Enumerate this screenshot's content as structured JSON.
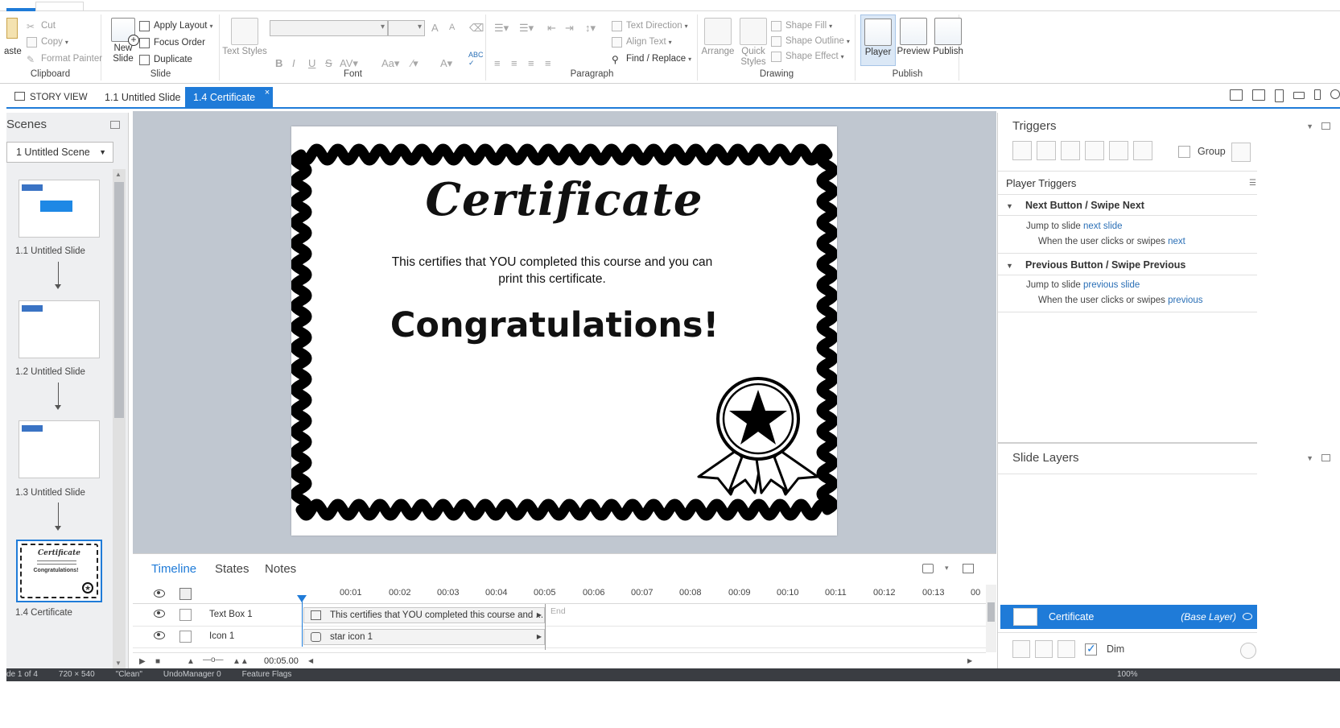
{
  "ribbon": {
    "clipboard": {
      "paste": "aste",
      "cut": "Cut",
      "copy": "Copy",
      "format_painter": "Format Painter",
      "label": "Clipboard"
    },
    "slide": {
      "new_slide": "New Slide",
      "apply_layout": "Apply Layout",
      "focus_order": "Focus Order",
      "duplicate": "Duplicate",
      "label": "Slide"
    },
    "font": {
      "text_styles": "Text Styles",
      "label": "Font"
    },
    "paragraph": {
      "text_direction": "Text Direction",
      "align_text": "Align Text",
      "find_replace": "Find / Replace",
      "label": "Paragraph"
    },
    "drawing": {
      "arrange": "Arrange",
      "quick_styles": "Quick Styles",
      "shape_fill": "Shape Fill",
      "shape_outline": "Shape Outline",
      "shape_effect": "Shape Effect",
      "label": "Drawing"
    },
    "publish": {
      "player": "Player",
      "preview": "Preview",
      "publish": "Publish",
      "label": "Publish"
    }
  },
  "doc_tabs": {
    "story_view": "STORY VIEW",
    "tab1": "1.1 Untitled Slide",
    "tab2": "1.4 Certificate",
    "close": "×"
  },
  "scenes": {
    "title": "Scenes",
    "selected_scene": "1 Untitled Scene",
    "slides": [
      {
        "label": "1.1 Untitled Slide"
      },
      {
        "label": "1.2 Untitled Slide"
      },
      {
        "label": "1.3 Untitled Slide"
      },
      {
        "label": "1.4 Certificate"
      }
    ],
    "thumb_cert_title": "Certificate",
    "thumb_cert_congrats": "Congratulations!"
  },
  "slide": {
    "title": "Certificate",
    "body": "This certifies that YOU completed this course and you can print this certificate.",
    "congrats": "Congratulations!"
  },
  "timeline": {
    "tabs": [
      "Timeline",
      "States",
      "Notes"
    ],
    "ticks": [
      "00:01",
      "00:02",
      "00:03",
      "00:04",
      "00:05",
      "00:06",
      "00:07",
      "00:08",
      "00:09",
      "00:10",
      "00:11",
      "00:12",
      "00:13",
      "00"
    ],
    "rows": [
      {
        "name": "Text Box 1",
        "bar": "This certifies that YOU completed this course and ..."
      },
      {
        "name": "Icon 1",
        "bar": "star icon 1"
      }
    ],
    "end_label": "End",
    "duration": "00:05.00"
  },
  "triggers": {
    "title": "Triggers",
    "group_label": "Group",
    "player_triggers": "Player Triggers",
    "groups": [
      {
        "name": "Next Button / Swipe Next",
        "action_prefix": "Jump to slide",
        "action_link": "next slide",
        "cond_prefix": "When the user clicks or swipes",
        "cond_link": "next"
      },
      {
        "name": "Previous Button / Swipe Previous",
        "action_prefix": "Jump to slide",
        "action_link": "previous slide",
        "cond_prefix": "When the user clicks or swipes",
        "cond_link": "previous"
      }
    ]
  },
  "layers": {
    "title": "Slide Layers",
    "base_name": "Certificate",
    "base_tag": "(Base Layer)",
    "dim_label": "Dim"
  },
  "status": {
    "items": [
      "de 1 of 4",
      "720 × 540",
      "\"Clean\"",
      "UndoManager 0",
      "Feature Flags"
    ],
    "zoom": "100%"
  },
  "colors": {
    "accent": "#1f7bd8",
    "canvas_bg": "#c0c7d0",
    "status_bg": "#3a3d42"
  }
}
